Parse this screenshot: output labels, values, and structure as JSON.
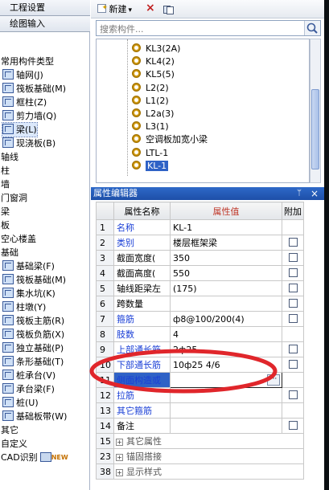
{
  "left_panel": {
    "tab_project_settings": "工程设置",
    "tab_drawing_input": "绘图输入",
    "tree": [
      {
        "label": "常用构件类型",
        "icon": "none"
      },
      {
        "label": "轴网(J)",
        "icon": "grid-icon"
      },
      {
        "label": "筏板基础(M)",
        "icon": "raft-foundation-icon"
      },
      {
        "label": "框柱(Z)",
        "icon": "frame-column-icon"
      },
      {
        "label": "剪力墙(Q)",
        "icon": "shear-wall-icon"
      },
      {
        "label": "梁(L)",
        "icon": "beam-icon",
        "selected": true
      },
      {
        "label": "现浇板(B)",
        "icon": "slab-icon"
      },
      {
        "label": "轴线",
        "icon": "none"
      },
      {
        "label": "柱",
        "icon": "none"
      },
      {
        "label": "墙",
        "icon": "none"
      },
      {
        "label": "门窗洞",
        "icon": "none"
      },
      {
        "label": "梁",
        "icon": "none"
      },
      {
        "label": "板",
        "icon": "none"
      },
      {
        "label": "空心楼盖",
        "icon": "none"
      },
      {
        "label": "基础",
        "icon": "none"
      },
      {
        "label": "基础梁(F)",
        "icon": "foundation-beam-icon"
      },
      {
        "label": "筏板基础(M)",
        "icon": "raft-foundation-icon"
      },
      {
        "label": "集水坑(K)",
        "icon": "sump-icon"
      },
      {
        "label": "柱墩(Y)",
        "icon": "column-pier-icon"
      },
      {
        "label": "筏板主筋(R)",
        "icon": "raft-main-rebar-icon"
      },
      {
        "label": "筏板负筋(X)",
        "icon": "raft-neg-rebar-icon"
      },
      {
        "label": "独立基础(P)",
        "icon": "isolated-footing-icon"
      },
      {
        "label": "条形基础(T)",
        "icon": "strip-footing-icon"
      },
      {
        "label": "桩承台(V)",
        "icon": "pile-cap-icon"
      },
      {
        "label": "承台梁(F)",
        "icon": "cap-beam-icon"
      },
      {
        "label": "桩(U)",
        "icon": "pile-icon"
      },
      {
        "label": "基础板带(W)",
        "icon": "foundation-strip-icon"
      },
      {
        "label": "其它",
        "icon": "none"
      },
      {
        "label": "自定义",
        "icon": "none"
      },
      {
        "label": "CAD识别",
        "icon": "cad-icon",
        "badge": "NEW"
      }
    ]
  },
  "toolbar": {
    "new_label": "新建",
    "new_dropdown": "▾",
    "delete_icon": "×"
  },
  "search": {
    "placeholder": "搜索构件..."
  },
  "component_list": [
    {
      "label": "KL3(2A)"
    },
    {
      "label": "KL4(2)"
    },
    {
      "label": "KL5(5)"
    },
    {
      "label": "L2(2)"
    },
    {
      "label": "L1(2)"
    },
    {
      "label": "L2a(3)"
    },
    {
      "label": "L3(1)"
    },
    {
      "label": "空调板加宽小梁"
    },
    {
      "label": "LTL-1"
    },
    {
      "label": "KL-1",
      "selected": true
    }
  ],
  "property_editor": {
    "title": "属性编辑器",
    "pin_icon": "ᛘ",
    "close_icon": "×",
    "headers": {
      "name": "属性名称",
      "value": "属性值",
      "extra": "附加"
    },
    "rows": [
      {
        "num": "1",
        "name": "名称",
        "value": "KL-1",
        "blue": true,
        "checkbox": false
      },
      {
        "num": "2",
        "name": "类别",
        "value": "楼层框架梁",
        "blue": true,
        "checkbox": true
      },
      {
        "num": "3",
        "name": "截面宽度(",
        "value": "350",
        "blue": false,
        "checkbox": true
      },
      {
        "num": "4",
        "name": "截面高度(",
        "value": "550",
        "blue": false,
        "checkbox": true
      },
      {
        "num": "5",
        "name": "轴线距梁左",
        "value": "(175)",
        "blue": false,
        "checkbox": true
      },
      {
        "num": "6",
        "name": "跨数量",
        "value": "",
        "blue": false,
        "checkbox": true
      },
      {
        "num": "7",
        "name": "箍筋",
        "value": "ф8@100/200(4)",
        "blue": true,
        "checkbox": true
      },
      {
        "num": "8",
        "name": "肢数",
        "value": "4",
        "blue": true,
        "checkbox": false
      },
      {
        "num": "9",
        "name": "上部通长筋",
        "value": "2ф25",
        "blue": true,
        "checkbox": true
      },
      {
        "num": "10",
        "name": "下部通长筋",
        "value": "10ф25 4/6",
        "blue": true,
        "checkbox": true
      },
      {
        "num": "11",
        "name": "侧面构造或",
        "value": "",
        "blue": true,
        "checkbox": false,
        "selected": true,
        "ellipsis": "···"
      },
      {
        "num": "12",
        "name": "拉筋",
        "value": "",
        "blue": true,
        "checkbox": true
      },
      {
        "num": "13",
        "name": "其它箍筋",
        "value": "",
        "blue": true,
        "checkbox": false
      },
      {
        "num": "14",
        "name": "备注",
        "value": "",
        "blue": false,
        "checkbox": true
      },
      {
        "num": "15",
        "name": "其它属性",
        "value": "",
        "group": true
      },
      {
        "num": "23",
        "name": "锚固搭接",
        "value": "",
        "group": true
      },
      {
        "num": "38",
        "name": "显示样式",
        "value": "",
        "group": true
      }
    ]
  },
  "colors": {
    "accent_blue": "#1a3fd6",
    "title_bar": "#2e69c8",
    "annotation_red": "#e0262b",
    "selection": "#2f62c6"
  }
}
